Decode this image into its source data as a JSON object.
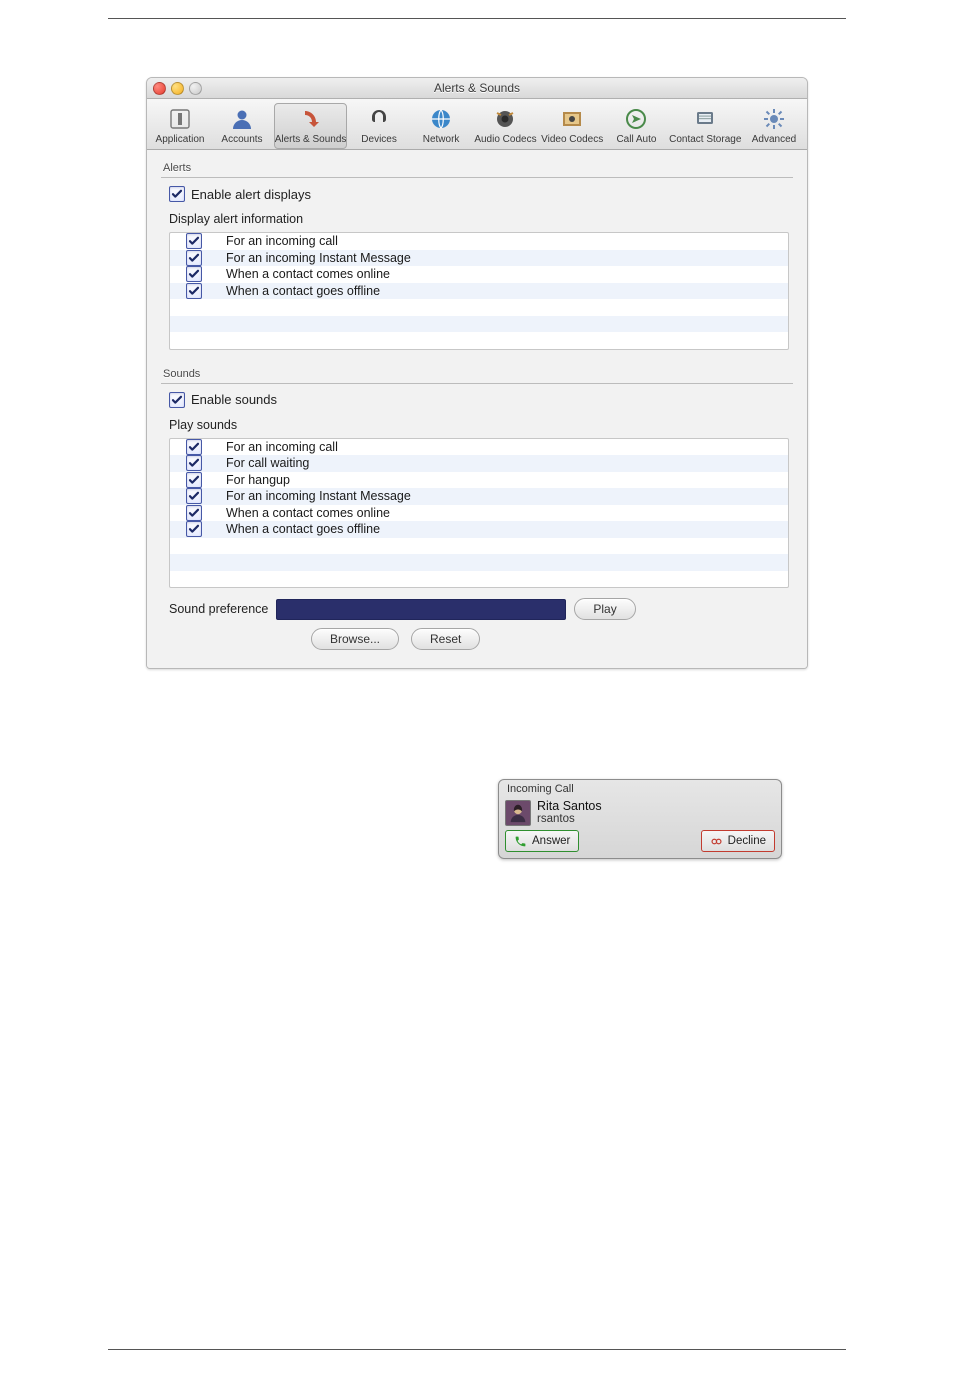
{
  "window": {
    "title": "Alerts & Sounds"
  },
  "toolbar": {
    "items": [
      {
        "label": "Application"
      },
      {
        "label": "Accounts"
      },
      {
        "label": "Alerts & Sounds"
      },
      {
        "label": "Devices"
      },
      {
        "label": "Network"
      },
      {
        "label": "Audio Codecs"
      },
      {
        "label": "Video Codecs"
      },
      {
        "label": "Call Auto"
      },
      {
        "label": "Contact Storage"
      },
      {
        "label": "Advanced"
      }
    ],
    "selected_index": 2
  },
  "alerts": {
    "section_title": "Alerts",
    "enable_label": "Enable alert displays",
    "enable_checked": true,
    "list_title": "Display alert information",
    "rows": [
      {
        "checked": true,
        "label": "For an incoming call"
      },
      {
        "checked": true,
        "label": "For an incoming Instant Message"
      },
      {
        "checked": true,
        "label": "When a contact comes online"
      },
      {
        "checked": true,
        "label": "When a contact goes offline"
      }
    ]
  },
  "sounds": {
    "section_title": "Sounds",
    "enable_label": "Enable sounds",
    "enable_checked": true,
    "list_title": "Play sounds",
    "rows": [
      {
        "checked": true,
        "label": "For an incoming call"
      },
      {
        "checked": true,
        "label": "For call waiting"
      },
      {
        "checked": true,
        "label": "For hangup"
      },
      {
        "checked": true,
        "label": "For an incoming Instant Message"
      },
      {
        "checked": true,
        "label": "When a contact comes online"
      },
      {
        "checked": true,
        "label": "When a contact goes offline"
      }
    ],
    "pref_label": "Sound preference",
    "pref_value": "",
    "play_label": "Play",
    "browse_label": "Browse...",
    "reset_label": "Reset"
  },
  "call_popup": {
    "title": "Incoming Call",
    "contact_name": "Rita Santos",
    "contact_user": "rsantos",
    "answer_label": "Answer",
    "decline_label": "Decline"
  }
}
